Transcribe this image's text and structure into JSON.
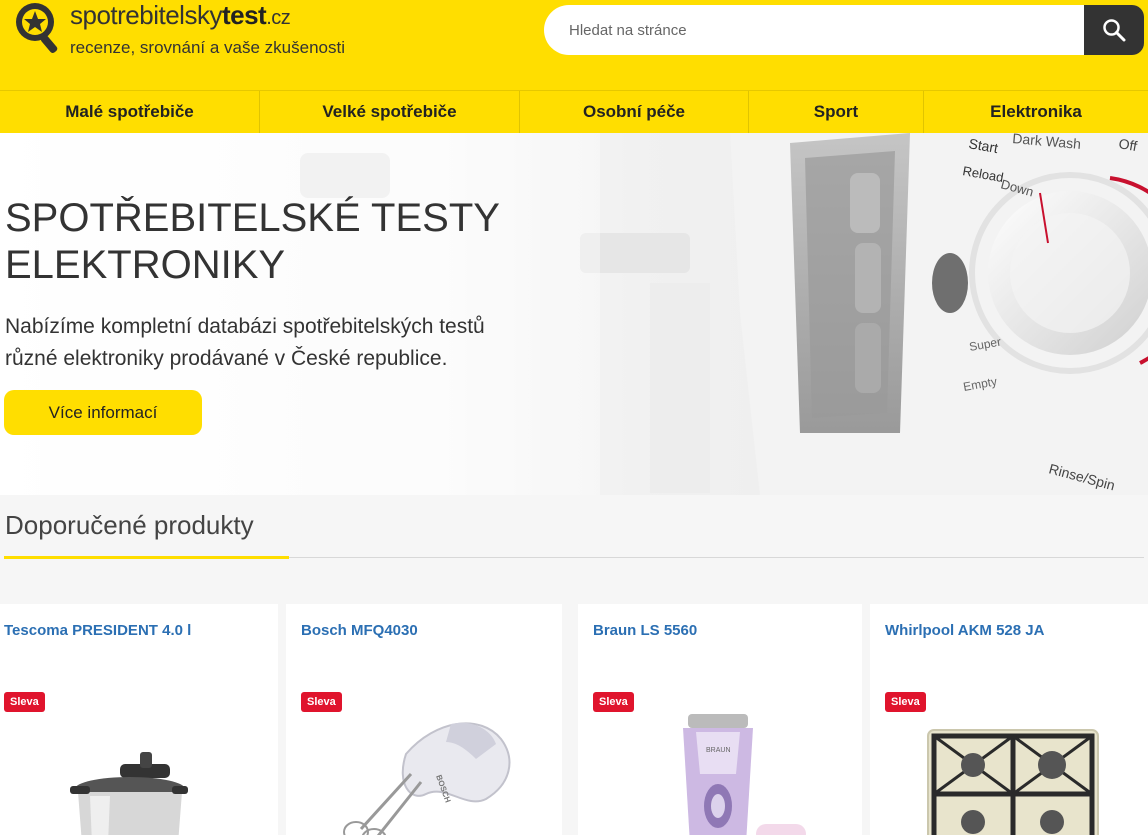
{
  "header": {
    "logo_light": "spotrebitelsky",
    "logo_bold": "test",
    "logo_tld": ".cz",
    "tagline": "recenze, srovnání a vaše zkušenosti",
    "search_placeholder": "Hledat na stránce"
  },
  "nav": {
    "items": [
      {
        "label": "Malé spotřebiče"
      },
      {
        "label": "Velké spotřebiče"
      },
      {
        "label": "Osobní péče"
      },
      {
        "label": "Sport"
      },
      {
        "label": "Elektronika"
      }
    ]
  },
  "hero": {
    "title_line1": "SPOTŘEBITELSKÉ TESTY",
    "title_line2": "ELEKTRONIKY",
    "text_line1": "Nabízíme kompletní databázi spotřebitelských testů",
    "text_line2": "různé elektroniky prodávané v České republice.",
    "button": "Více informací",
    "panel_labels": [
      "Start",
      "Reload",
      "Dark Wash",
      "Down",
      "Off",
      "Super",
      "Empty",
      "Rinse/Spin"
    ]
  },
  "section": {
    "title": "Doporučené produkty"
  },
  "products": [
    {
      "name": "Tescoma PRESIDENT 4.0 l",
      "badge": "Sleva",
      "icon": "pressure-cooker-image"
    },
    {
      "name": "Bosch MFQ4030",
      "badge": "Sleva",
      "icon": "hand-mixer-image",
      "brand": "BOSCH"
    },
    {
      "name": "Braun LS 5560",
      "badge": "Sleva",
      "icon": "lady-shaver-image",
      "brand": "BRAUN"
    },
    {
      "name": "Whirlpool AKM 528 JA",
      "badge": "Sleva",
      "icon": "gas-hob-image"
    }
  ],
  "colors": {
    "brand_yellow": "#ffde00",
    "dark": "#333333",
    "link_blue": "#2b6fb3",
    "badge_red": "#e0142d"
  }
}
